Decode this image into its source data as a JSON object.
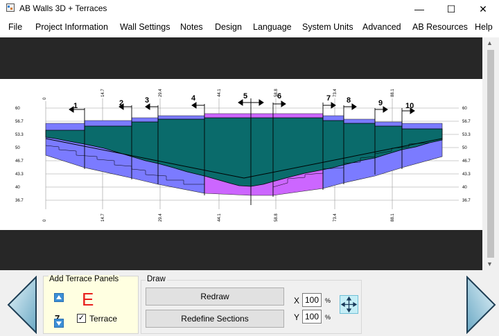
{
  "window": {
    "title": "AB Walls 3D + Terraces",
    "minimize": "—",
    "maximize": "☐",
    "close": "✕"
  },
  "menu": [
    "File",
    "Project Information",
    "Wall Settings",
    "Notes",
    "Design",
    "Language",
    "System Units",
    "Advanced",
    "AB Resources",
    "Help"
  ],
  "drawing": {
    "x_ticks_top": [
      "0",
      "14.7",
      "29.4",
      "44.1",
      "58.8",
      "73.4",
      "88.1"
    ],
    "x_ticks_bottom": [
      "0",
      "14.7",
      "29.4",
      "44.1",
      "58.8",
      "73.4",
      "88.1"
    ],
    "y_ticks": [
      "60",
      "56.7",
      "53.3",
      "50",
      "46.7",
      "43.3",
      "40",
      "36.7"
    ],
    "sections": [
      "1",
      "2",
      "3",
      "4",
      "5",
      "6",
      "7",
      "8",
      "9",
      "10"
    ],
    "colors": {
      "blue_panel": "#7b7bff",
      "magenta_panel": "#cc66ff",
      "teal_fill": "#0a6b6b",
      "outline": "#000000"
    }
  },
  "terrace_panel": {
    "legend": "Add Terrace Panels",
    "count": "7",
    "letter": "E",
    "checkbox_label": "Terrace",
    "checked": true
  },
  "draw_panel": {
    "legend": "Draw",
    "redraw": "Redraw",
    "redefine": "Redefine Sections",
    "x_label": "X",
    "x_value": "100",
    "y_label": "Y",
    "y_value": "100",
    "percent": "%"
  }
}
